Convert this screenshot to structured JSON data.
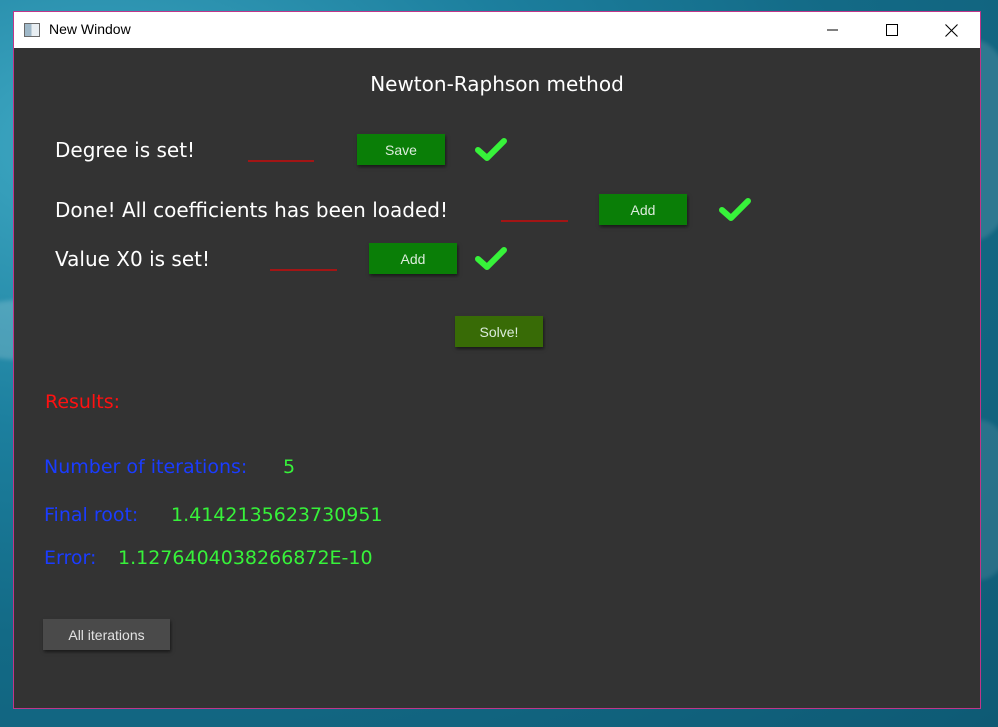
{
  "window": {
    "title": "New Window"
  },
  "heading": "Newton-Raphson method",
  "rows": [
    {
      "label": "Degree is set!",
      "button_label": "Save"
    },
    {
      "label": "Done! All coefficients has been loaded!",
      "button_label": "Add"
    },
    {
      "label": "Value X0 is set!",
      "button_label": "Add"
    }
  ],
  "solve_label": "Solve!",
  "results": {
    "title": "Results:",
    "iterations_label": "Number of iterations:",
    "iterations_value": "5",
    "root_label": "Final root:",
    "root_value": "1.4142135623730951",
    "error_label": "Error:",
    "error_value": "1.1276404038266872E-10"
  },
  "all_iterations_label": "All iterations",
  "colors": {
    "background": "#333333",
    "button_green": "#0a7e07",
    "solve_green": "#386b06",
    "check_green": "#37f23a",
    "results_red": "#ff1111",
    "label_blue": "#1a3cff",
    "value_green": "#37f23a"
  },
  "icons": [
    "window-app-icon",
    "minimize-icon",
    "maximize-icon",
    "close-icon",
    "check-icon"
  ]
}
